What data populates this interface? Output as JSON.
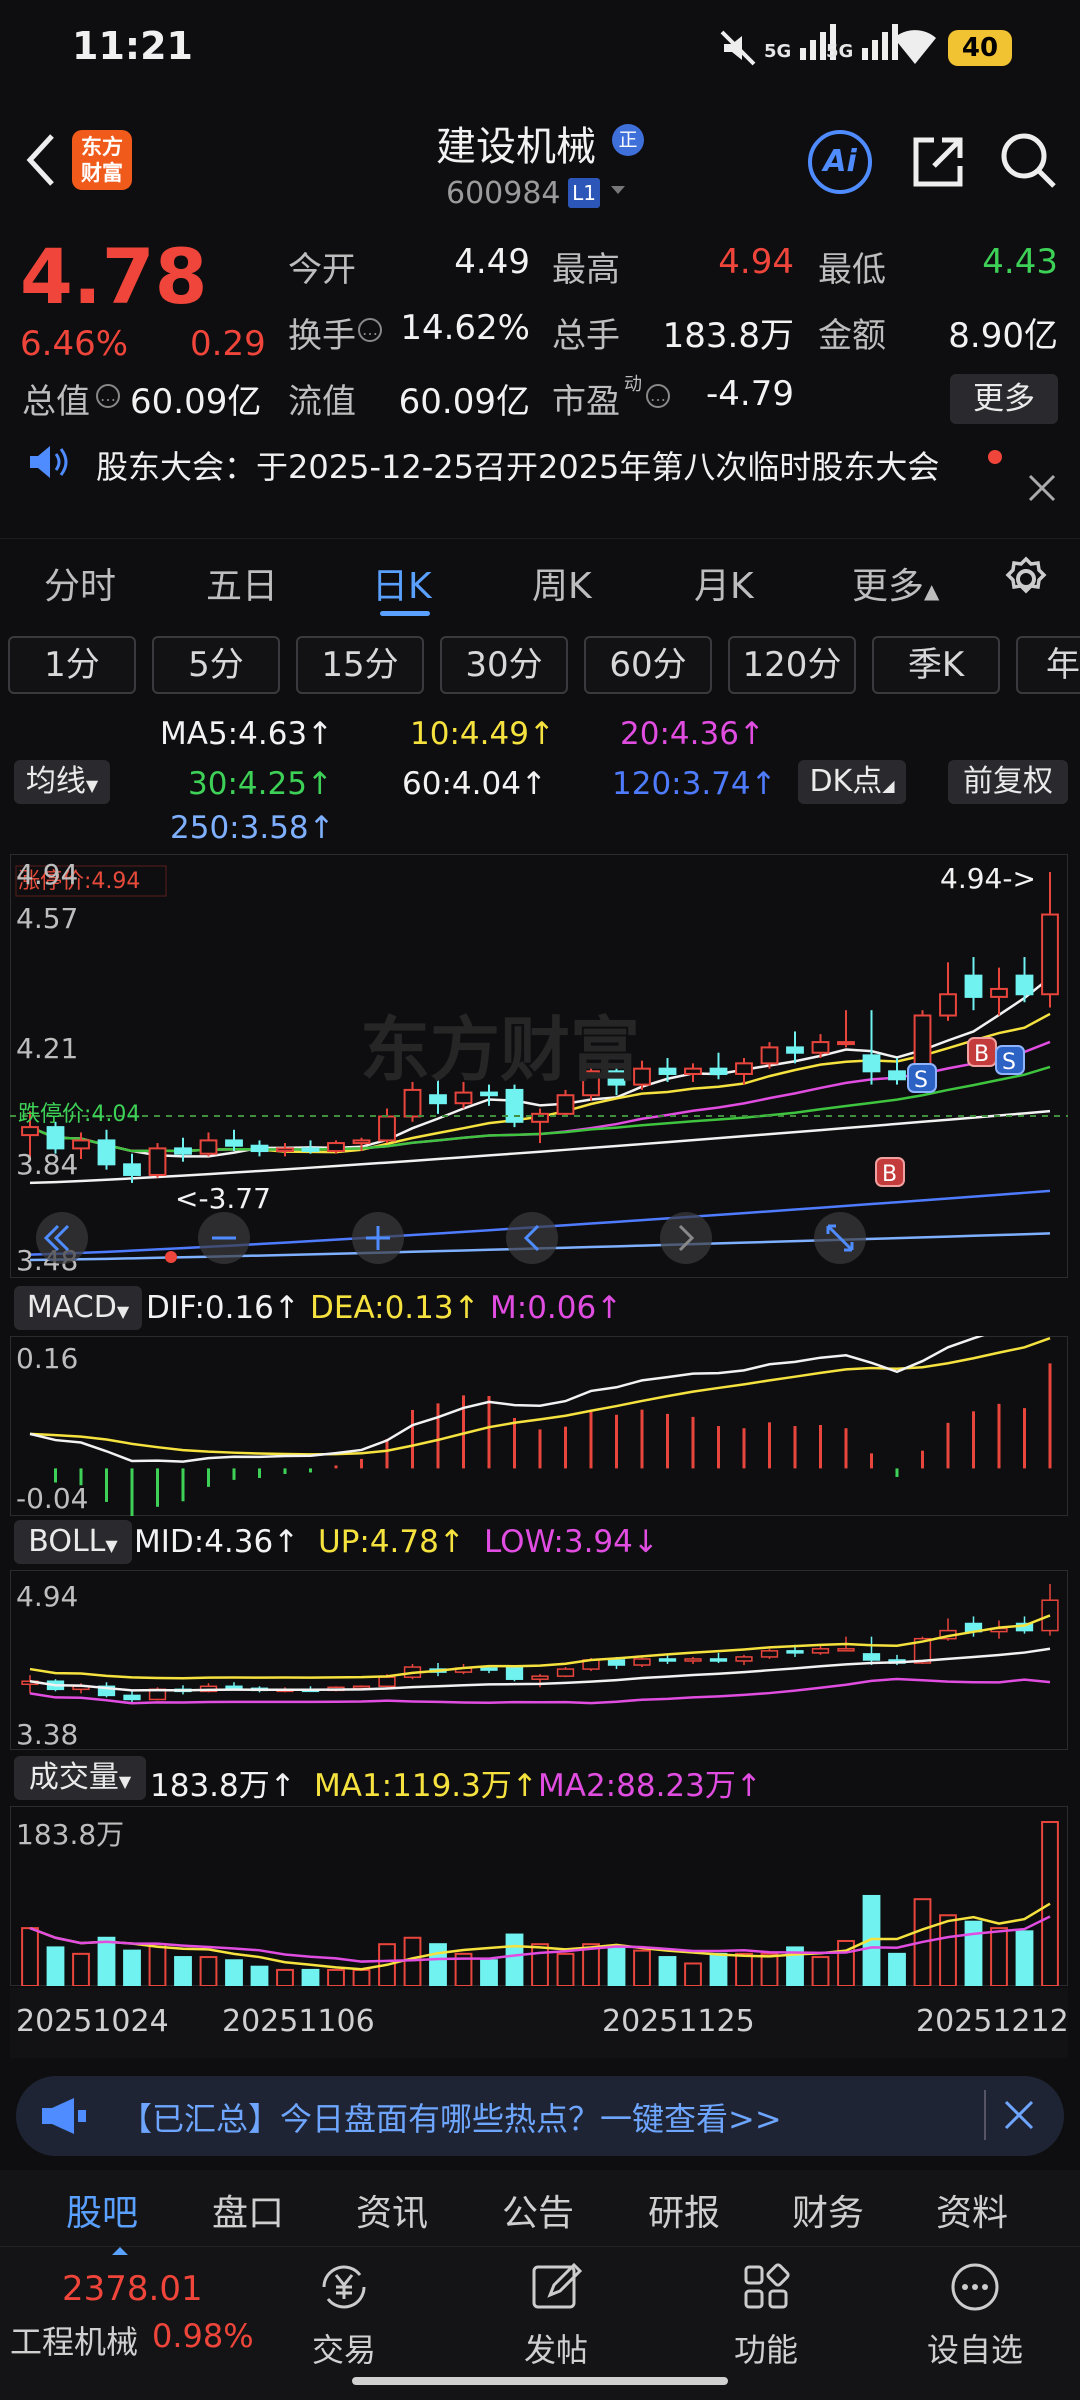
{
  "status_bar": {
    "time": "11:21",
    "network_1": "5G",
    "network_2": "5G",
    "battery": "40"
  },
  "header": {
    "back_label": "‹",
    "logo_text": "东方财富",
    "stock_name": "建设机械",
    "badge": "正",
    "stock_code": "600984",
    "level": "L1"
  },
  "quote": {
    "price": "4.78",
    "change_pct": "6.46%",
    "change_abs": "0.29",
    "open_label": "今开",
    "open": "4.49",
    "high_label": "最高",
    "high": "4.94",
    "low_label": "最低",
    "low": "4.43",
    "turnover_label": "换手",
    "turnover": "14.62%",
    "volume_label": "总手",
    "volume": "183.8万",
    "amount_label": "金额",
    "amount": "8.90亿",
    "mktcap_label": "总值",
    "mktcap": "60.09亿",
    "float_label": "流值",
    "float_cap": "60.09亿",
    "pe_label": "市盈",
    "pe_sup": "动",
    "pe": "-4.79",
    "more_label": "更多"
  },
  "notice": {
    "text": "股东大会：于2025-12-25召开2025年第八次临时股东大会"
  },
  "chart_tabs": [
    "分时",
    "五日",
    "日K",
    "周K",
    "月K",
    "更多"
  ],
  "active_chart_tab": "日K",
  "periods": [
    "1分",
    "5分",
    "15分",
    "30分",
    "60分",
    "120分",
    "季K",
    "年"
  ],
  "ma_legend": {
    "selector": "均线",
    "ma5": "MA5:4.63↑",
    "ma10": "10:4.49↑",
    "ma20": "20:4.36↑",
    "ma30": "30:4.25↑",
    "ma60": "60:4.04↑",
    "ma120": "120:3.74↑",
    "ma250": "250:3.58↑",
    "dk_label": "DK点",
    "adjust_label": "前复权"
  },
  "kline": {
    "limit_up_label": "涨停价:4.94",
    "limit_down_label": "跌停价:4.04",
    "y_ticks": [
      "4.94",
      "4.57",
      "4.21",
      "3.84",
      "3.48"
    ],
    "max_label": "4.94->",
    "min_label": "<-3.77",
    "signals": [
      "S",
      "B",
      "S",
      "B"
    ],
    "watermark": "东方财富"
  },
  "macd": {
    "selector": "MACD",
    "dif": "DIF:0.16↑",
    "dea": "DEA:0.13↑",
    "m": "M:0.06↑",
    "y_top": "0.16",
    "y_bottom": "-0.04"
  },
  "boll": {
    "selector": "BOLL",
    "mid": "MID:4.36↑",
    "up": "UP:4.78↑",
    "low": "LOW:3.94↓",
    "y_top": "4.94",
    "y_bottom": "3.38"
  },
  "vol": {
    "selector": "成交量",
    "value": "183.8万↑",
    "ma1": "MA1:119.3万↑",
    "ma2": "MA2:88.23万↑",
    "y_top": "183.8万"
  },
  "x_dates": [
    "20251024",
    "20251106",
    "20251125",
    "20251212"
  ],
  "banner": {
    "text": "【已汇总】今日盘面有哪些热点？一键查看>>"
  },
  "bottom_tabs": [
    "股吧",
    "盘口",
    "资讯",
    "公告",
    "研报",
    "财务",
    "资料"
  ],
  "active_bottom_tab": "股吧",
  "sector": {
    "value": "2378.01",
    "name": "工程机械",
    "pct": "0.98%"
  },
  "bottom_actions": [
    "交易",
    "发帖",
    "功能",
    "设自选"
  ],
  "chart_data": {
    "type": "candlestick",
    "ylim": [
      3.48,
      4.94
    ],
    "candles": [
      {
        "o": 3.95,
        "h": 4.04,
        "l": 3.86,
        "c": 3.98
      },
      {
        "o": 3.98,
        "h": 4.0,
        "l": 3.88,
        "c": 3.9
      },
      {
        "o": 3.9,
        "h": 3.96,
        "l": 3.86,
        "c": 3.93
      },
      {
        "o": 3.93,
        "h": 3.97,
        "l": 3.82,
        "c": 3.84
      },
      {
        "o": 3.84,
        "h": 3.88,
        "l": 3.77,
        "c": 3.8
      },
      {
        "o": 3.8,
        "h": 3.92,
        "l": 3.79,
        "c": 3.9
      },
      {
        "o": 3.9,
        "h": 3.94,
        "l": 3.85,
        "c": 3.88
      },
      {
        "o": 3.88,
        "h": 3.96,
        "l": 3.87,
        "c": 3.93
      },
      {
        "o": 3.93,
        "h": 3.97,
        "l": 3.89,
        "c": 3.91
      },
      {
        "o": 3.91,
        "h": 3.93,
        "l": 3.87,
        "c": 3.89
      },
      {
        "o": 3.89,
        "h": 3.92,
        "l": 3.87,
        "c": 3.9
      },
      {
        "o": 3.9,
        "h": 3.93,
        "l": 3.88,
        "c": 3.89
      },
      {
        "o": 3.89,
        "h": 3.93,
        "l": 3.88,
        "c": 3.92
      },
      {
        "o": 3.92,
        "h": 3.94,
        "l": 3.89,
        "c": 3.93
      },
      {
        "o": 3.93,
        "h": 4.05,
        "l": 3.92,
        "c": 4.02
      },
      {
        "o": 4.02,
        "h": 4.15,
        "l": 4.0,
        "c": 4.12
      },
      {
        "o": 4.1,
        "h": 4.16,
        "l": 4.03,
        "c": 4.07
      },
      {
        "o": 4.07,
        "h": 4.15,
        "l": 4.05,
        "c": 4.11
      },
      {
        "o": 4.11,
        "h": 4.14,
        "l": 4.06,
        "c": 4.1
      },
      {
        "o": 4.12,
        "h": 4.14,
        "l": 3.98,
        "c": 4.0
      },
      {
        "o": 4.0,
        "h": 4.05,
        "l": 3.92,
        "c": 4.03
      },
      {
        "o": 4.03,
        "h": 4.12,
        "l": 4.02,
        "c": 4.1
      },
      {
        "o": 4.1,
        "h": 4.21,
        "l": 4.08,
        "c": 4.19
      },
      {
        "o": 4.19,
        "h": 4.22,
        "l": 4.1,
        "c": 4.14
      },
      {
        "o": 4.14,
        "h": 4.23,
        "l": 4.12,
        "c": 4.2
      },
      {
        "o": 4.2,
        "h": 4.24,
        "l": 4.15,
        "c": 4.18
      },
      {
        "o": 4.18,
        "h": 4.22,
        "l": 4.15,
        "c": 4.2
      },
      {
        "o": 4.2,
        "h": 4.26,
        "l": 4.16,
        "c": 4.18
      },
      {
        "o": 4.18,
        "h": 4.24,
        "l": 4.14,
        "c": 4.22
      },
      {
        "o": 4.22,
        "h": 4.3,
        "l": 4.2,
        "c": 4.28
      },
      {
        "o": 4.28,
        "h": 4.34,
        "l": 4.22,
        "c": 4.26
      },
      {
        "o": 4.26,
        "h": 4.33,
        "l": 4.24,
        "c": 4.3
      },
      {
        "o": 4.3,
        "h": 4.42,
        "l": 4.28,
        "c": 4.3
      },
      {
        "o": 4.25,
        "h": 4.42,
        "l": 4.14,
        "c": 4.19
      },
      {
        "o": 4.19,
        "h": 4.24,
        "l": 4.14,
        "c": 4.16
      },
      {
        "o": 4.16,
        "h": 4.42,
        "l": 4.15,
        "c": 4.4
      },
      {
        "o": 4.4,
        "h": 4.6,
        "l": 4.38,
        "c": 4.48
      },
      {
        "o": 4.55,
        "h": 4.62,
        "l": 4.42,
        "c": 4.47
      },
      {
        "o": 4.47,
        "h": 4.58,
        "l": 4.4,
        "c": 4.5
      },
      {
        "o": 4.55,
        "h": 4.62,
        "l": 4.45,
        "c": 4.48
      },
      {
        "o": 4.48,
        "h": 4.94,
        "l": 4.43,
        "c": 4.78
      }
    ]
  }
}
